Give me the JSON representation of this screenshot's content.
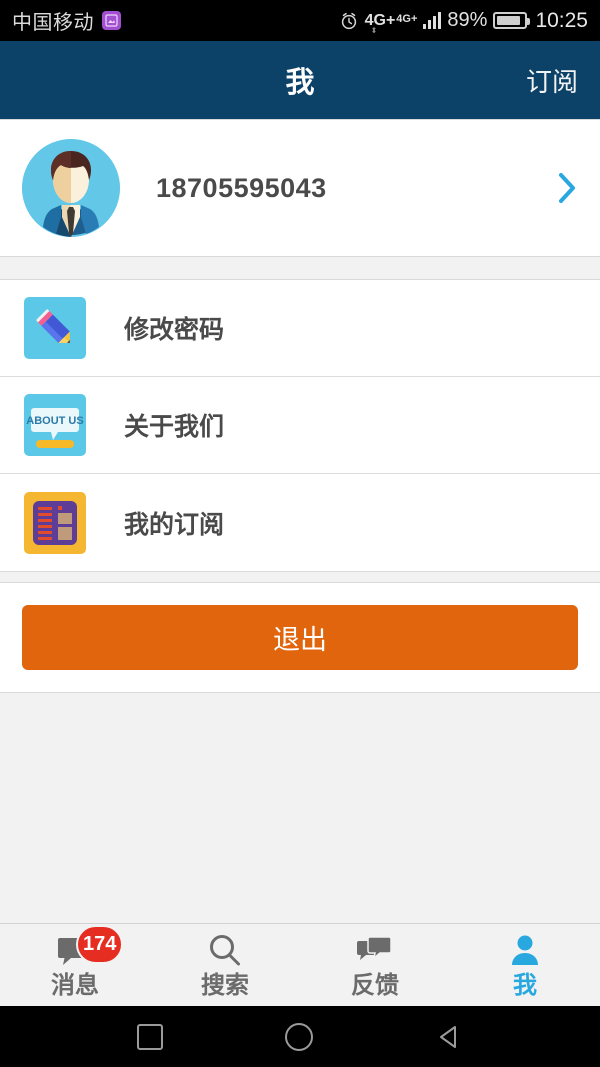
{
  "status_bar": {
    "carrier": "中国移动",
    "app_icon": "image-icon",
    "alarm_icon": "alarm-icon",
    "network_primary": "4G+",
    "network_secondary": "4G+",
    "signal_icon": "signal-bars-icon",
    "battery_percent": "89%",
    "battery_icon": "battery-icon",
    "time": "10:25"
  },
  "header": {
    "title": "我",
    "action_label": "订阅",
    "background_color": "#0c4268"
  },
  "profile": {
    "avatar_icon": "user-avatar",
    "phone": "18705595043",
    "chevron_icon": "chevron-right-icon",
    "chevron_color": "#29a8e0"
  },
  "menu": {
    "items": [
      {
        "label": "修改密码",
        "icon": "pencil-icon",
        "icon_bg": "#5bc8e8"
      },
      {
        "label": "关于我们",
        "icon": "about-us-icon",
        "icon_bg": "#5bc8e8"
      },
      {
        "label": "我的订阅",
        "icon": "newspaper-icon",
        "icon_bg": "#f5b731"
      }
    ]
  },
  "logout": {
    "label": "退出",
    "color": "#e1650d"
  },
  "tabbar": {
    "active_color": "#29a8e0",
    "inactive_color": "#6b6b6b",
    "badge_color": "#e62d22",
    "items": [
      {
        "label": "消息",
        "icon": "chat-bubble-icon",
        "badge": "174",
        "active": false
      },
      {
        "label": "搜索",
        "icon": "search-icon",
        "badge": "",
        "active": false
      },
      {
        "label": "反馈",
        "icon": "feedback-bubbles-icon",
        "badge": "",
        "active": false
      },
      {
        "label": "我",
        "icon": "person-icon",
        "badge": "",
        "active": true
      }
    ]
  },
  "android_nav": {
    "recents_icon": "square-icon",
    "home_icon": "circle-icon",
    "back_icon": "triangle-back-icon"
  }
}
